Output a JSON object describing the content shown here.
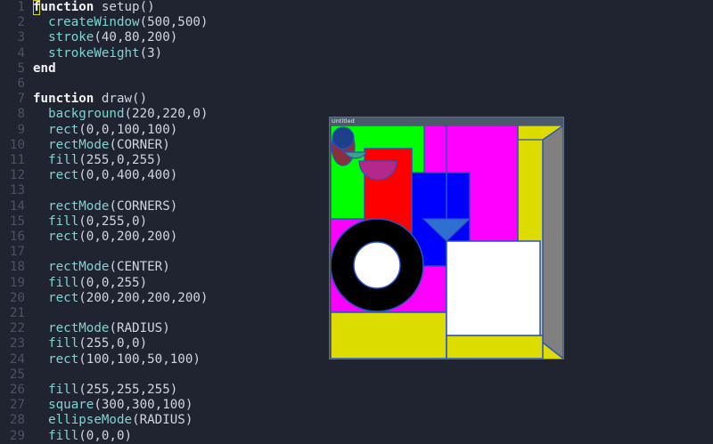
{
  "editor": {
    "lines": [
      {
        "n": "1",
        "indent": "",
        "tokens": [
          [
            "kw",
            "function"
          ],
          [
            "code",
            " setup()"
          ]
        ]
      },
      {
        "n": "2",
        "indent": "  ",
        "tokens": [
          [
            "fn",
            "createWindow"
          ],
          [
            "code",
            "(500,500)"
          ]
        ]
      },
      {
        "n": "3",
        "indent": "  ",
        "tokens": [
          [
            "fn",
            "stroke"
          ],
          [
            "code",
            "(40,80,200)"
          ]
        ]
      },
      {
        "n": "4",
        "indent": "  ",
        "tokens": [
          [
            "fn",
            "strokeWeight"
          ],
          [
            "code",
            "(3)"
          ]
        ]
      },
      {
        "n": "5",
        "indent": "",
        "tokens": [
          [
            "kw",
            "end"
          ]
        ]
      },
      {
        "n": "6",
        "indent": "",
        "tokens": []
      },
      {
        "n": "7",
        "indent": "",
        "tokens": [
          [
            "kw",
            "function"
          ],
          [
            "code",
            " draw()"
          ]
        ]
      },
      {
        "n": "8",
        "indent": "  ",
        "tokens": [
          [
            "fn",
            "background"
          ],
          [
            "code",
            "(220,220,0)"
          ]
        ]
      },
      {
        "n": "9",
        "indent": "  ",
        "tokens": [
          [
            "fn",
            "rect"
          ],
          [
            "code",
            "(0,0,100,100)"
          ]
        ]
      },
      {
        "n": "10",
        "indent": "  ",
        "tokens": [
          [
            "fn",
            "rectMode"
          ],
          [
            "code",
            "(CORNER)"
          ]
        ]
      },
      {
        "n": "11",
        "indent": "  ",
        "tokens": [
          [
            "fn",
            "fill"
          ],
          [
            "code",
            "(255,0,255)"
          ]
        ]
      },
      {
        "n": "12",
        "indent": "  ",
        "tokens": [
          [
            "fn",
            "rect"
          ],
          [
            "code",
            "(0,0,400,400)"
          ]
        ]
      },
      {
        "n": "13",
        "indent": "",
        "tokens": []
      },
      {
        "n": "14",
        "indent": "  ",
        "tokens": [
          [
            "fn",
            "rectMode"
          ],
          [
            "code",
            "(CORNERS)"
          ]
        ]
      },
      {
        "n": "15",
        "indent": "  ",
        "tokens": [
          [
            "fn",
            "fill"
          ],
          [
            "code",
            "(0,255,0)"
          ]
        ]
      },
      {
        "n": "16",
        "indent": "  ",
        "tokens": [
          [
            "fn",
            "rect"
          ],
          [
            "code",
            "(0,0,200,200)"
          ]
        ]
      },
      {
        "n": "17",
        "indent": "",
        "tokens": []
      },
      {
        "n": "18",
        "indent": "  ",
        "tokens": [
          [
            "fn",
            "rectMode"
          ],
          [
            "code",
            "(CENTER)"
          ]
        ]
      },
      {
        "n": "19",
        "indent": "  ",
        "tokens": [
          [
            "fn",
            "fill"
          ],
          [
            "code",
            "(0,0,255)"
          ]
        ]
      },
      {
        "n": "20",
        "indent": "  ",
        "tokens": [
          [
            "fn",
            "rect"
          ],
          [
            "code",
            "(200,200,200,200)"
          ]
        ]
      },
      {
        "n": "21",
        "indent": "",
        "tokens": []
      },
      {
        "n": "22",
        "indent": "  ",
        "tokens": [
          [
            "fn",
            "rectMode"
          ],
          [
            "code",
            "(RADIUS)"
          ]
        ]
      },
      {
        "n": "23",
        "indent": "  ",
        "tokens": [
          [
            "fn",
            "fill"
          ],
          [
            "code",
            "(255,0,0)"
          ]
        ]
      },
      {
        "n": "24",
        "indent": "  ",
        "tokens": [
          [
            "fn",
            "rect"
          ],
          [
            "code",
            "(100,100,50,100)"
          ]
        ]
      },
      {
        "n": "25",
        "indent": "",
        "tokens": []
      },
      {
        "n": "26",
        "indent": "  ",
        "tokens": [
          [
            "fn",
            "fill"
          ],
          [
            "code",
            "(255,255,255)"
          ]
        ]
      },
      {
        "n": "27",
        "indent": "  ",
        "tokens": [
          [
            "fn",
            "square"
          ],
          [
            "code",
            "(300,300,100)"
          ]
        ]
      },
      {
        "n": "28",
        "indent": "  ",
        "tokens": [
          [
            "fn",
            "ellipseMode"
          ],
          [
            "code",
            "(RADIUS)"
          ]
        ]
      },
      {
        "n": "29",
        "indent": "  ",
        "tokens": [
          [
            "fn",
            "fill"
          ],
          [
            "code",
            "(0,0,0)"
          ]
        ]
      }
    ]
  },
  "window": {
    "title": "Untitled"
  },
  "colors": {
    "editor_bg": "#1f2430",
    "keyword": "#f2f2f2",
    "function": "#7fd4d4",
    "code": "#cfd6e0",
    "line_number": "#4a5263",
    "cursor": "#d7d23a",
    "stroke": "#2850c8",
    "background": "#dcdc00",
    "magenta": "#ff00ff",
    "green": "#00ff00",
    "blue": "#0000ff",
    "red": "#ff0000",
    "white": "#ffffff",
    "black": "#000000",
    "gray": "#808080"
  }
}
